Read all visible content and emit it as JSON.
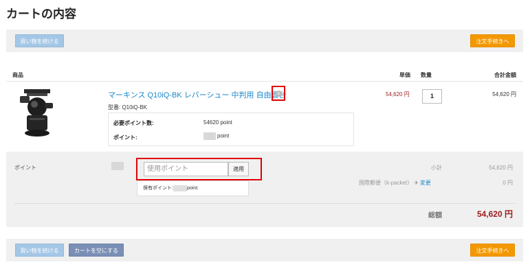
{
  "page": {
    "title": "カートの内容"
  },
  "actions": {
    "continue_label": "買い物を続ける",
    "checkout_label": "注文手続きへ",
    "clear_label": "カートを空にする"
  },
  "table_headers": {
    "product": "商品",
    "unit_price": "単価",
    "quantity": "数量",
    "total": "合計金額"
  },
  "item": {
    "name": "マーキンス Q10iQ-BK レバーシュー 中判用 自由雲台",
    "model": "型番: Q10iQ-BK",
    "remove_icon": "close-circle-icon",
    "required_points_label": "必要ポイント数:",
    "required_points_value": "54620 point",
    "points_label": "ポイント:",
    "points_value": "point",
    "unit_price": "54,620 円",
    "quantity": "1",
    "line_total": "54,620 円"
  },
  "summary": {
    "points_label": "ポイント",
    "use_points_placeholder": "使用ポイント",
    "apply_label": "適用",
    "owned_points_prefix": "保有ポイント:",
    "owned_points_suffix": "point.",
    "subtotal_label": "小計",
    "subtotal_value": "54,620 円",
    "shipping_label": "国際郵便（k-packet）",
    "shipping_change": "変更",
    "shipping_value": "0 円",
    "grand_total_label": "総額",
    "grand_total_value": "54,620 円"
  },
  "colors": {
    "accent_orange": "#f39800",
    "link_blue": "#1a86c8",
    "price_red": "#9a1b1b",
    "highlight_red": "#e00000"
  }
}
